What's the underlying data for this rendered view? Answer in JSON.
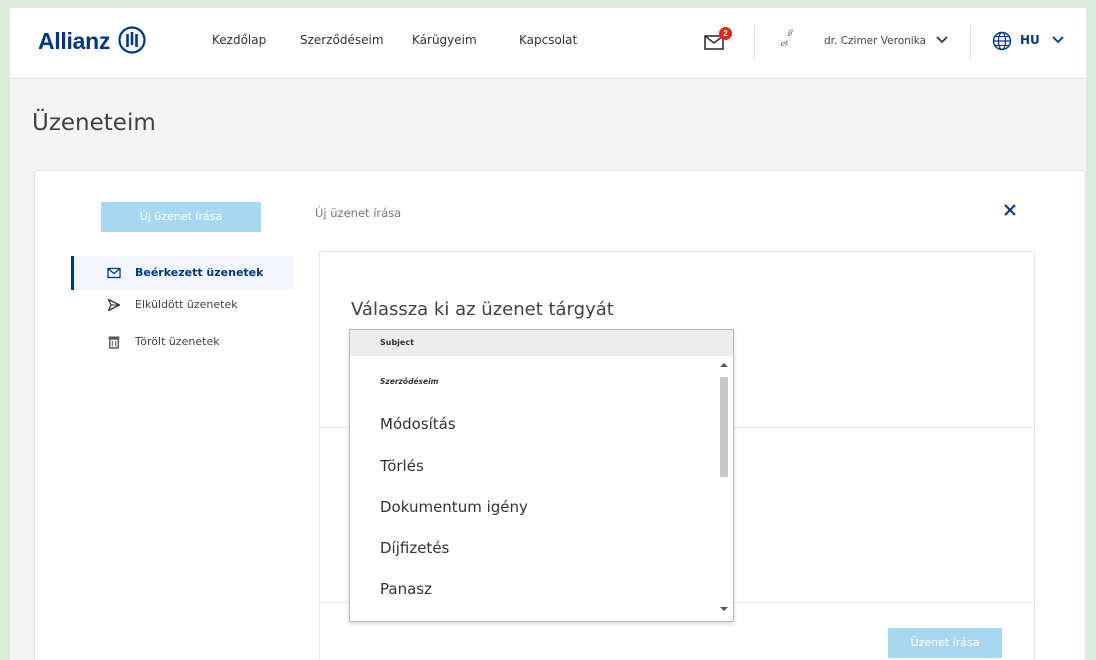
{
  "header": {
    "logo": "Allianz",
    "nav": [
      "Kezdőlap",
      "Szerződéseim",
      "Kárügyeim",
      "Kapcsolat"
    ],
    "mail_badge": "2",
    "user_name": "dr. Czimer Veronika",
    "language": "HU",
    "brand_color": "#003781",
    "badge_color": "#d52b1e"
  },
  "page": {
    "title": "Üzeneteim"
  },
  "sidebar": {
    "new_message_button": "Új üzenet írása",
    "items": [
      {
        "label": "Beérkezett üzenetek",
        "icon": "envelope-icon",
        "active": true
      },
      {
        "label": "Elküldött üzenetek",
        "icon": "send-icon",
        "active": false
      },
      {
        "label": "Törölt üzenetek",
        "icon": "trash-icon",
        "active": false
      }
    ]
  },
  "compose": {
    "breadcrumb": "Új üzenet írása",
    "heading": "Válassza ki az üzenet tárgyát",
    "send_button": "Üzenet írása"
  },
  "subject_dropdown": {
    "selected": "Subject",
    "group_label": "Szerződéseim",
    "options": [
      "Módosítás",
      "Törlés",
      "Dokumentum igény",
      "Díjfizetés",
      "Panasz"
    ]
  }
}
